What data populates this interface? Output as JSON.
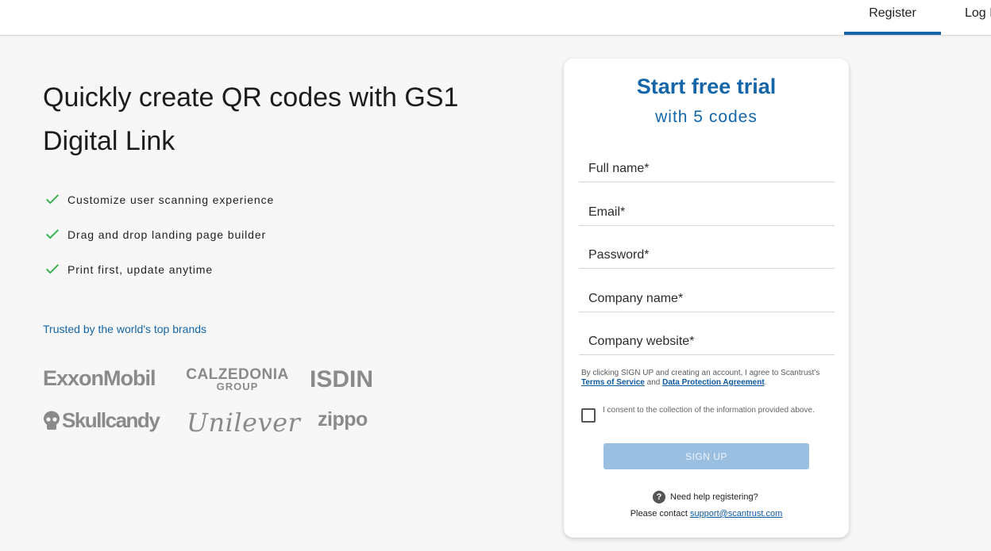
{
  "nav": {
    "register": "Register",
    "login": "Log In"
  },
  "hero": {
    "headline": "Quickly create QR codes with GS1 Digital Link",
    "features": [
      "Customize user scanning experience",
      "Drag and drop landing page builder",
      "Print first, update anytime"
    ],
    "trusted": "Trusted by the world's top brands",
    "brands": {
      "exxon": "ExxonMobil",
      "calzedonia_l1": "CALZEDONIA",
      "calzedonia_l2": "GROUP",
      "isdin": "ISDIN",
      "skullcandy": "Skullcandy",
      "unilever": "Unilever",
      "zippo": "zippo"
    }
  },
  "form": {
    "title": "Start free trial",
    "subtitle": "with 5 codes",
    "fields": {
      "full_name": "Full name*",
      "email": "Email*",
      "password": "Password*",
      "company_name": "Company name*",
      "company_website": "Company website*"
    },
    "terms_prefix": "By clicking SIGN UP and creating an account, I agree to Scantrust's",
    "terms_link": "Terms of Service",
    "terms_and": "and",
    "dpa_link": "Data Protection Agreement",
    "terms_suffix": ".",
    "consent": "I consent to the collection of the information provided above.",
    "signup": "SIGN UP",
    "help": "Need help registering?",
    "contact_prefix": "Please contact",
    "contact_email": "support@scantrust.com"
  },
  "colors": {
    "accent": "#1466a8",
    "check": "#2fae4e",
    "button_disabled": "#9bbfe0"
  }
}
